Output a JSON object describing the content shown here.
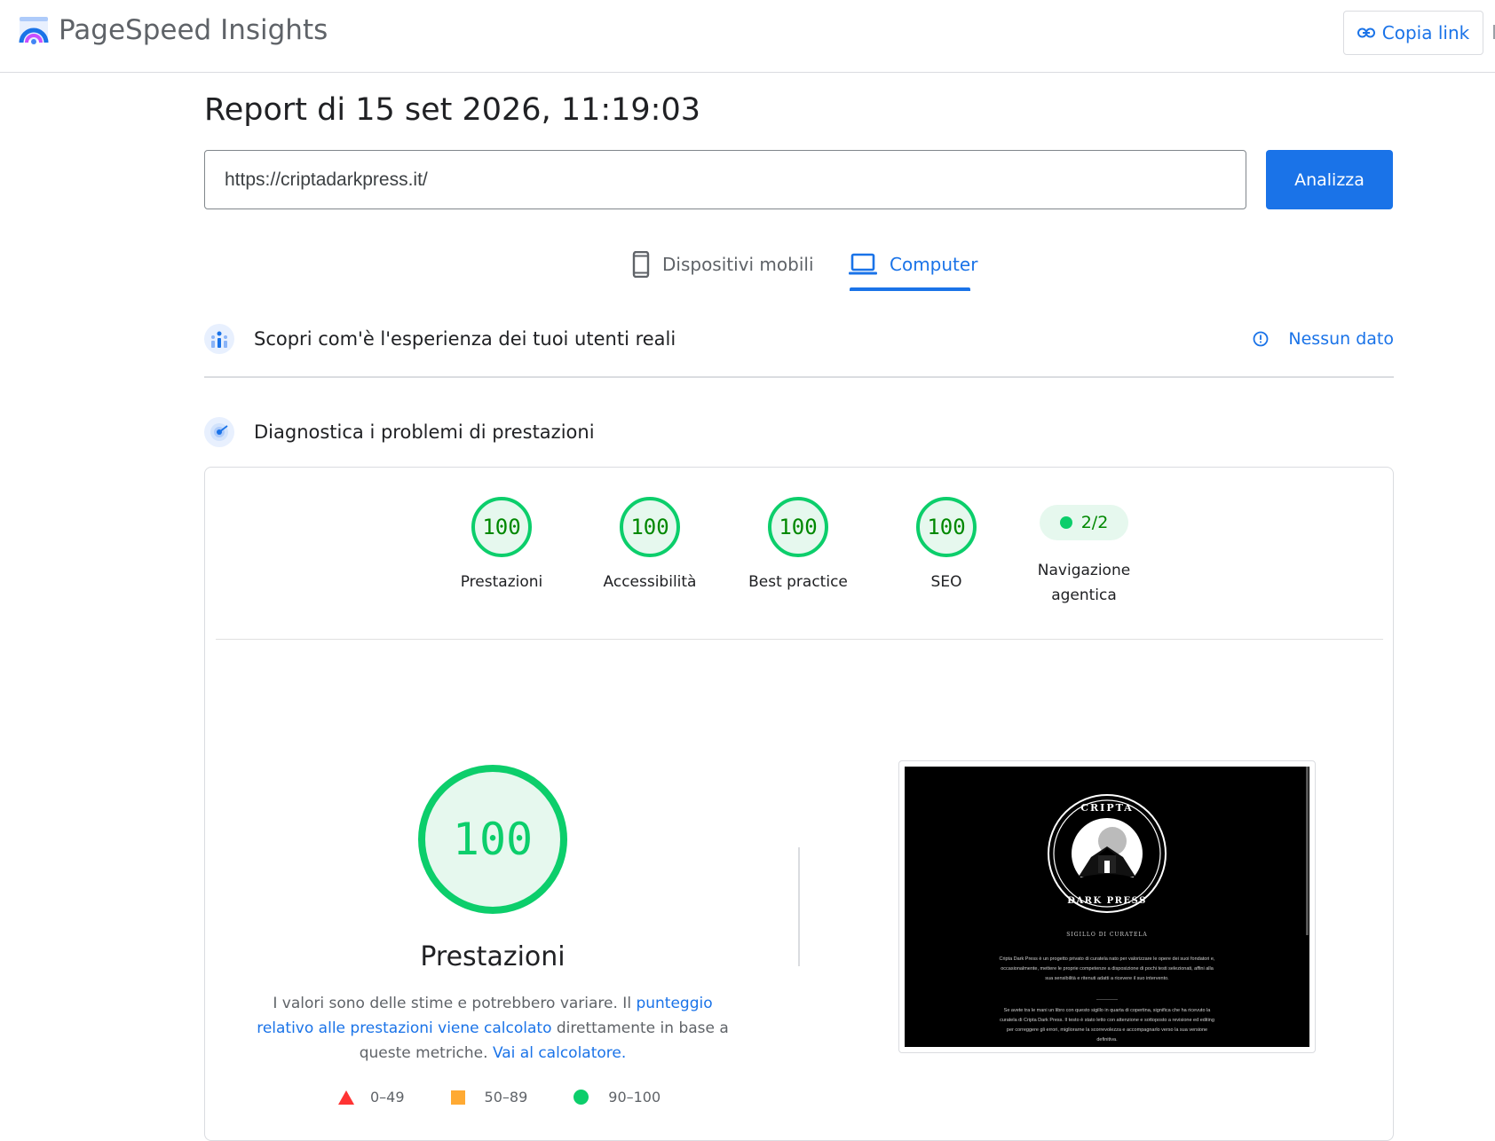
{
  "header": {
    "app_title": "PageSpeed Insights",
    "copy_link_label": "Copia link"
  },
  "report": {
    "title": "Report di 15 set 2026, 11:19:03"
  },
  "search": {
    "url_value": "https://criptadarkpress.it/",
    "analyze_label": "Analizza"
  },
  "tabs": [
    {
      "label": "Dispositivi mobili",
      "icon": "smartphone-icon",
      "active": false
    },
    {
      "label": "Computer",
      "icon": "laptop-icon",
      "active": true
    }
  ],
  "field_data": {
    "title": "Scopri com'è l'esperienza dei tuoi utenti reali",
    "status_label": "Nessun dato"
  },
  "diagnostics": {
    "title": "Diagnostica i problemi di prestazioni"
  },
  "scores": [
    {
      "label": "Prestazioni",
      "value": "100"
    },
    {
      "label": "Accessibilità",
      "value": "100"
    },
    {
      "label": "Best practice",
      "value": "100"
    },
    {
      "label": "SEO",
      "value": "100"
    }
  ],
  "agentic": {
    "value": "2/2",
    "label_line1": "Navigazione",
    "label_line2": "agentica"
  },
  "performance": {
    "score": "100",
    "title": "Prestazioni",
    "note_part1": "I valori sono delle stime e potrebbero variare. Il ",
    "note_link1": "punteggio relativo alle prestazioni viene calcolato",
    "note_part2": " direttamente in base a queste metriche. ",
    "note_link2": "Vai al calcolatore."
  },
  "legend": [
    {
      "range": "0–49",
      "color": "#ff3333",
      "shape": "triangle"
    },
    {
      "range": "50–89",
      "color": "#ffaa33",
      "shape": "square"
    },
    {
      "range": "90–100",
      "color": "#0cce6b",
      "shape": "circle"
    }
  ],
  "thumbnail": {
    "seal_top_text": "CRIPTA",
    "seal_bottom_text": "DARK PRESS",
    "heading": "SIGILLO DI CURATELA",
    "para1": "Cripta Dark Press è un progetto privato di curatela nato per valorizzare le opere dei suoi fondatori e, occasionalmente, mettere le proprie competenze a disposizione di pochi testi selezionati, affini alla sua sensibilità e ritenuti adatti a ricevere il suo intervento.",
    "para2": "Se avete tra le mani un libro con questo sigillo in quarta di copertina, significa che ha ricevuto la curatela di Cripta Dark Press. Il testo è stato letto con attenzione e sottoposto a revisione ed editing per correggere gli errori, migliorarne la scorrevolezza e accompagnarlo verso la sua versione definitiva."
  },
  "colors": {
    "accent": "#1a73e8",
    "pass_green": "#0cce6b",
    "pass_text": "#008800",
    "pass_bg": "#e6f8ee"
  }
}
